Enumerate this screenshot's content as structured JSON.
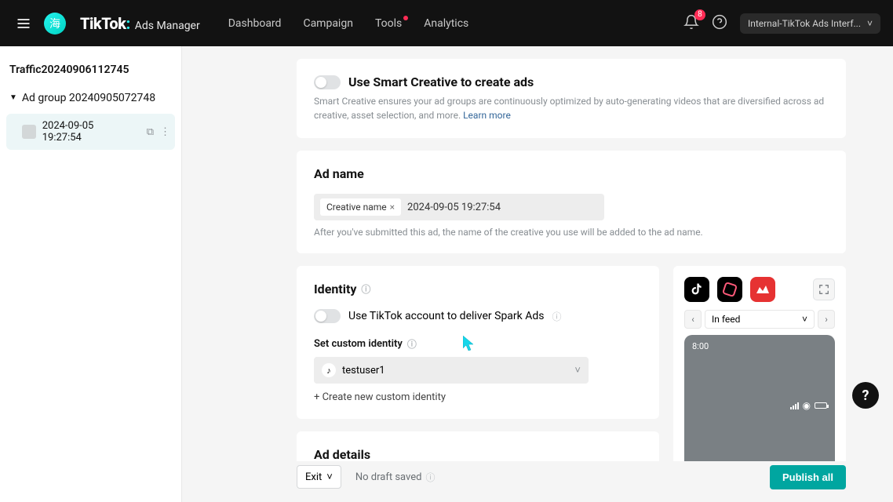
{
  "header": {
    "brand_name": "TikTok",
    "brand_sub": "Ads Manager",
    "nav": [
      "Dashboard",
      "Campaign",
      "Tools",
      "Analytics"
    ],
    "tools_has_dot": true,
    "bell_count": "8",
    "account_label": "Internal-TikTok Ads Interf...",
    "avatar_char": "海"
  },
  "sidebar": {
    "campaign": "Traffic20240906112745",
    "adgroup": "Ad group 20240905072748",
    "ad_item": "2024-09-05 19:27:54"
  },
  "smart_creative": {
    "title": "Use Smart Creative to create ads",
    "desc": "Smart Creative ensures your ad groups are continuously optimized by auto-generating videos that are diversified across ad creative, asset selection, and more. ",
    "learn_more": "Learn more"
  },
  "adname": {
    "section_title": "Ad name",
    "chip": "Creative name",
    "value": "2024-09-05 19:27:54",
    "note": "After you've submitted this ad, the name of the creative you use will be added to the ad name."
  },
  "identity": {
    "section_title": "Identity",
    "spark_toggle": "Use TikTok account to deliver Spark Ads",
    "custom_label": "Set custom identity",
    "selected": "testuser1",
    "create_link": "+  Create new custom identity"
  },
  "ad_details": {
    "section_title": "Ad details"
  },
  "preview": {
    "placement_label": "In feed",
    "phone_time": "8:00"
  },
  "footer": {
    "exit": "Exit",
    "draft": "No draft saved",
    "publish": "Publish all"
  }
}
